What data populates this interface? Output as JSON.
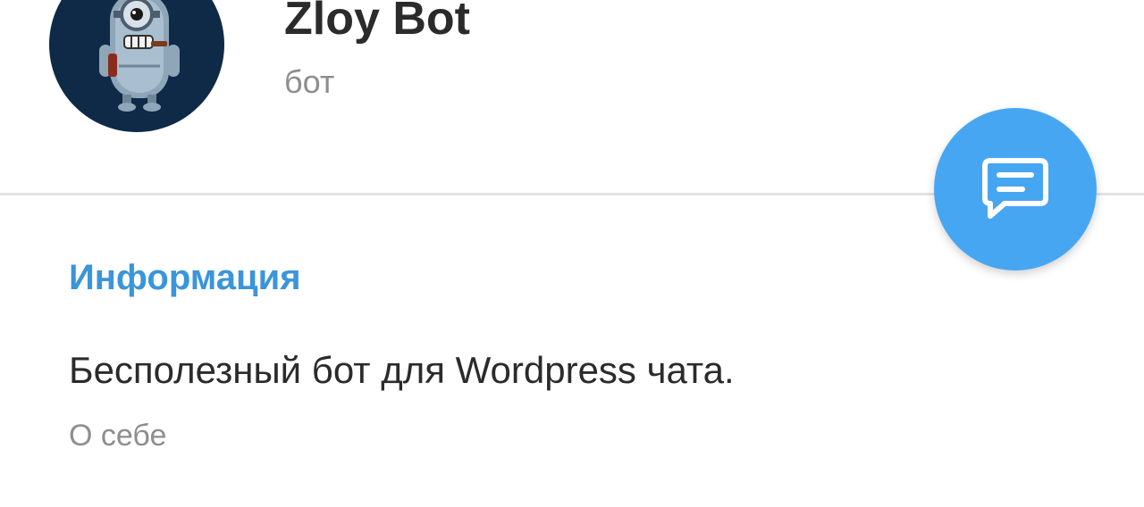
{
  "profile": {
    "name": "Zloy Bot",
    "status": "бот"
  },
  "info_section": {
    "title": "Информация",
    "about_value": "Бесполезный бот для Wordpress чата.",
    "about_label": "О себе"
  },
  "fab": {
    "icon": "message-icon"
  },
  "colors": {
    "accent": "#3a95da",
    "fab": "#47a6f2",
    "avatar_bg": "#0e2a47",
    "text_primary": "#2b2b2b",
    "text_secondary": "#8e8e8e",
    "divider": "#e3e3e3"
  }
}
